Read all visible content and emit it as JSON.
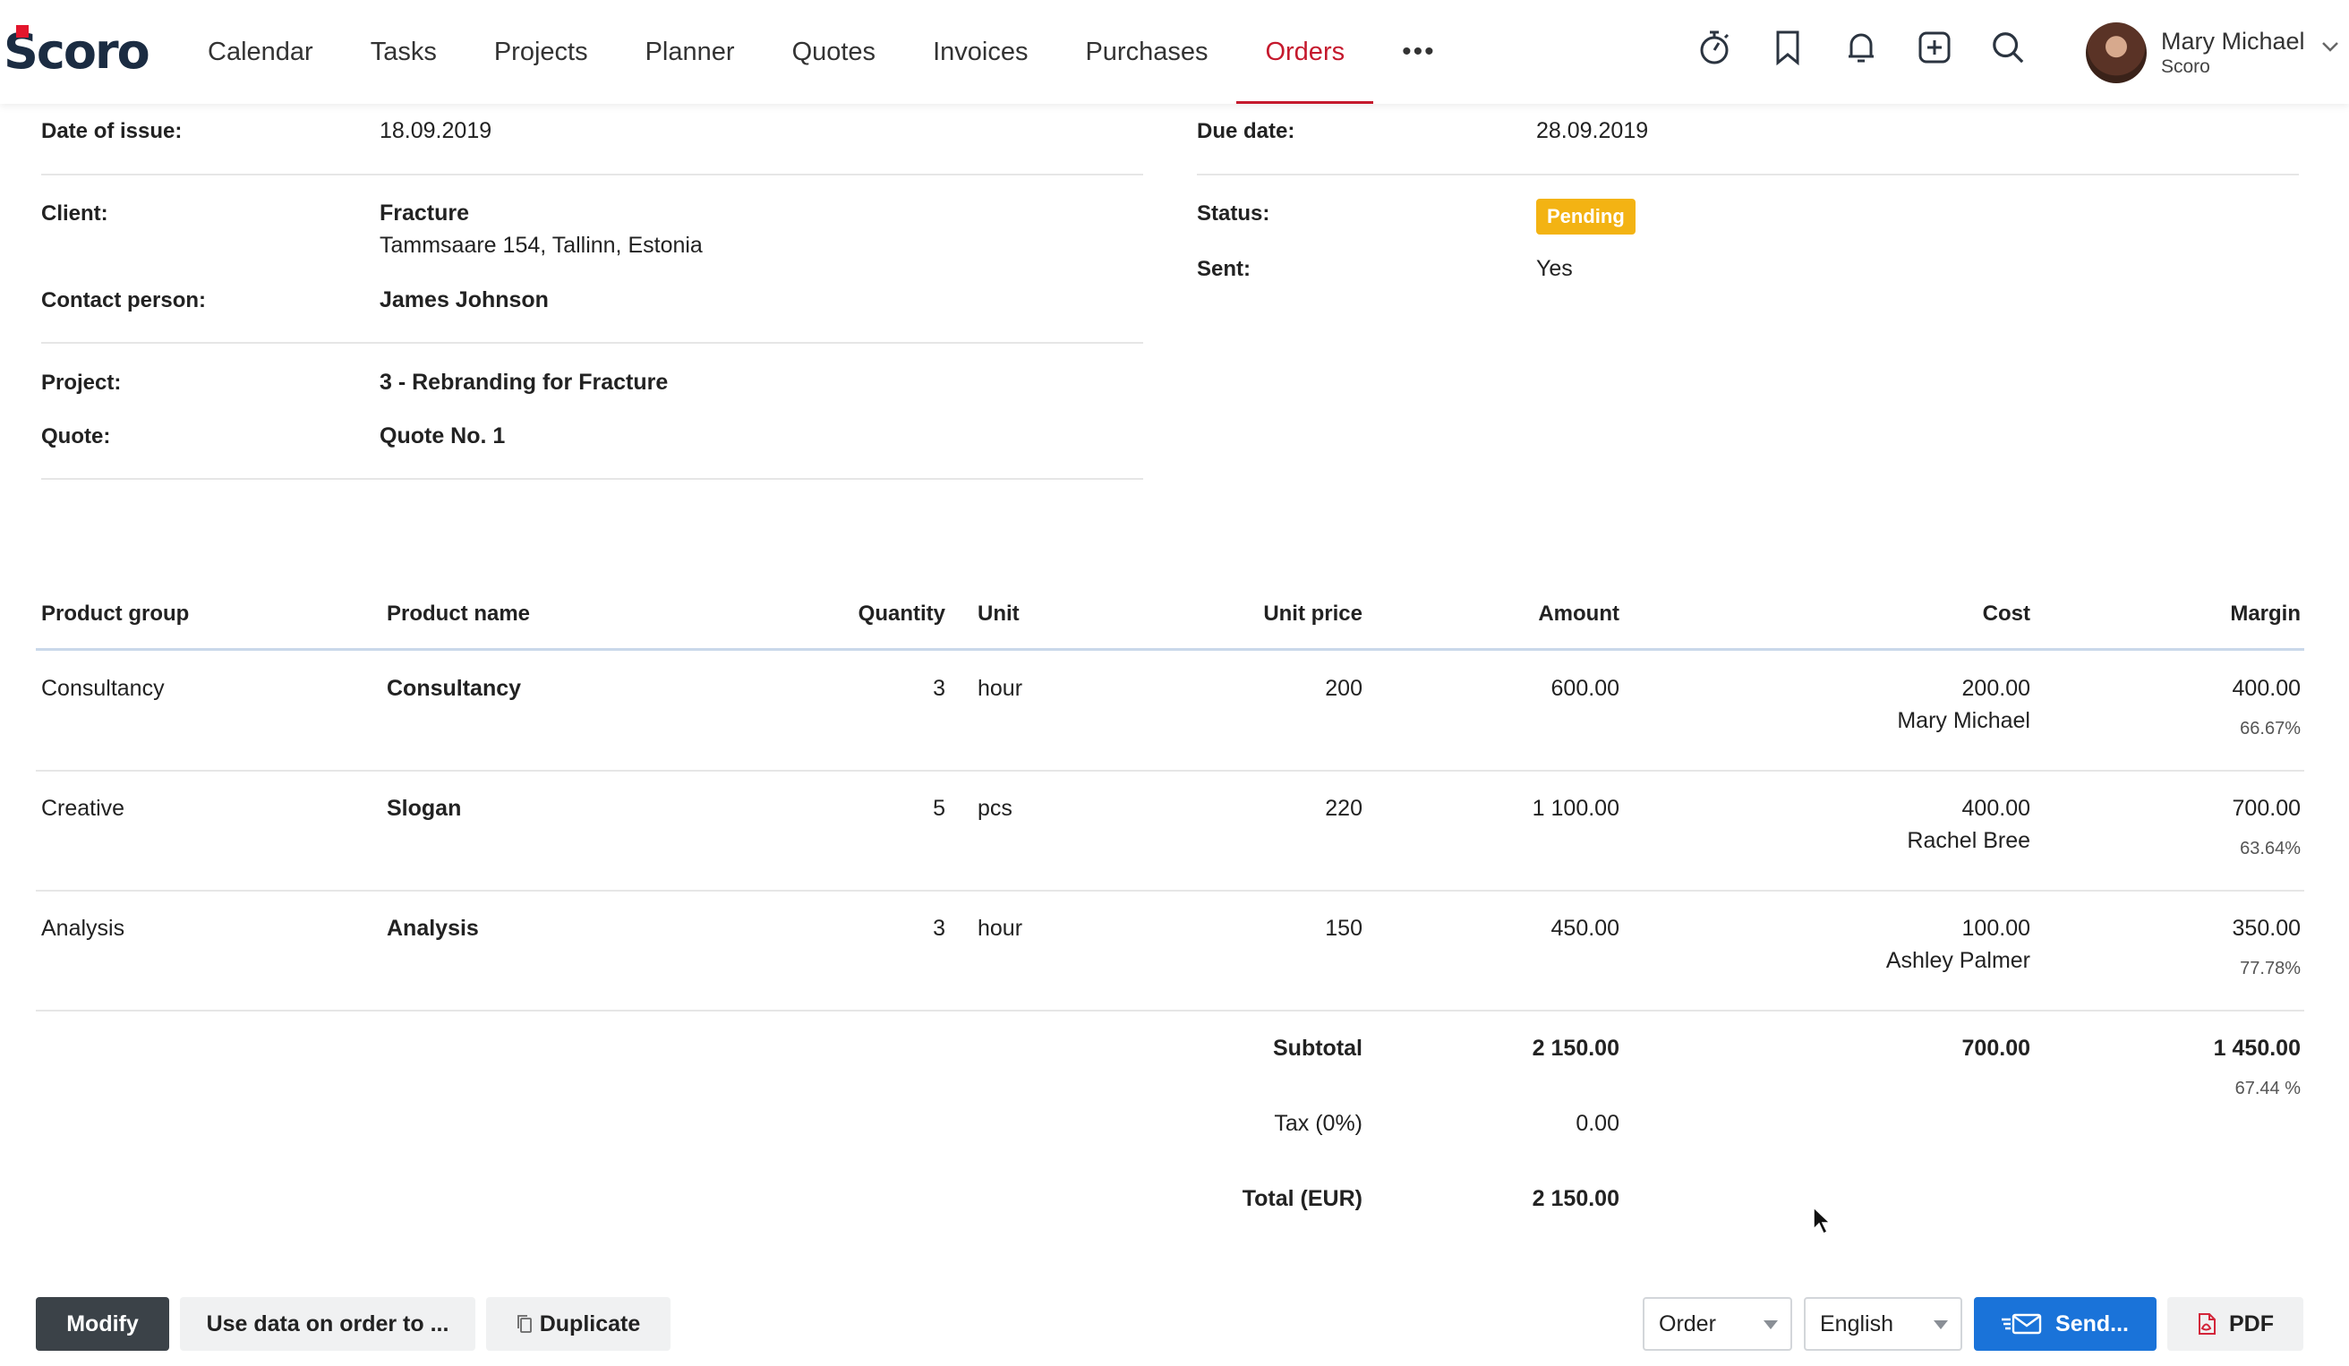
{
  "app": {
    "logo_text": "Scoro"
  },
  "nav": {
    "items": [
      "Calendar",
      "Tasks",
      "Projects",
      "Planner",
      "Quotes",
      "Invoices",
      "Purchases",
      "Orders"
    ],
    "active": "Orders",
    "more_label": "•••"
  },
  "header_icons": [
    "stopwatch-icon",
    "bookmark-icon",
    "bell-icon",
    "add-icon",
    "search-icon"
  ],
  "user": {
    "name": "Mary Michael",
    "company": "Scoro"
  },
  "order": {
    "date_of_issue_label": "Date of issue:",
    "date_of_issue": "18.09.2019",
    "due_date_label": "Due date:",
    "due_date": "28.09.2019",
    "client_label": "Client:",
    "client_name": "Fracture",
    "client_address": "Tammsaare 154, Tallinn, Estonia",
    "status_label": "Status:",
    "status": "Pending",
    "status_color": "#f3b313",
    "sent_label": "Sent:",
    "sent": "Yes",
    "contact_label": "Contact person:",
    "contact": "James Johnson",
    "project_label": "Project:",
    "project": "3 - Rebranding for Fracture",
    "quote_label": "Quote:",
    "quote": "Quote No. 1"
  },
  "table": {
    "headers": {
      "group": "Product group",
      "name": "Product name",
      "quantity": "Quantity",
      "unit": "Unit",
      "unit_price": "Unit price",
      "amount": "Amount",
      "cost": "Cost",
      "margin": "Margin"
    },
    "rows": [
      {
        "group": "Consultancy",
        "name": "Consultancy",
        "quantity": "3",
        "unit": "hour",
        "unit_price": "200",
        "amount": "600.00",
        "cost": "200.00",
        "cost_person": "Mary Michael",
        "margin": "400.00",
        "margin_pct": "66.67%"
      },
      {
        "group": "Creative",
        "name": "Slogan",
        "quantity": "5",
        "unit": "pcs",
        "unit_price": "220",
        "amount": "1 100.00",
        "cost": "400.00",
        "cost_person": "Rachel Bree",
        "margin": "700.00",
        "margin_pct": "63.64%"
      },
      {
        "group": "Analysis",
        "name": "Analysis",
        "quantity": "3",
        "unit": "hour",
        "unit_price": "150",
        "amount": "450.00",
        "cost": "100.00",
        "cost_person": "Ashley Palmer",
        "margin": "350.00",
        "margin_pct": "77.78%"
      }
    ],
    "subtotal_label": "Subtotal",
    "subtotal_amount": "2 150.00",
    "subtotal_cost": "700.00",
    "subtotal_margin": "1 450.00",
    "subtotal_margin_pct": "67.44 %",
    "tax_label": "Tax (0%)",
    "tax_amount": "0.00",
    "total_label": "Total (EUR)",
    "total_amount": "2 150.00"
  },
  "actions": {
    "modify": "Modify",
    "use_data": "Use data on order to ...",
    "duplicate": "Duplicate",
    "doc_type": "Order",
    "language": "English",
    "send": "Send...",
    "pdf": "PDF"
  },
  "colors": {
    "accent": "#c5192d",
    "primary_button": "#1a73d9",
    "dark_button": "#3b4248"
  }
}
